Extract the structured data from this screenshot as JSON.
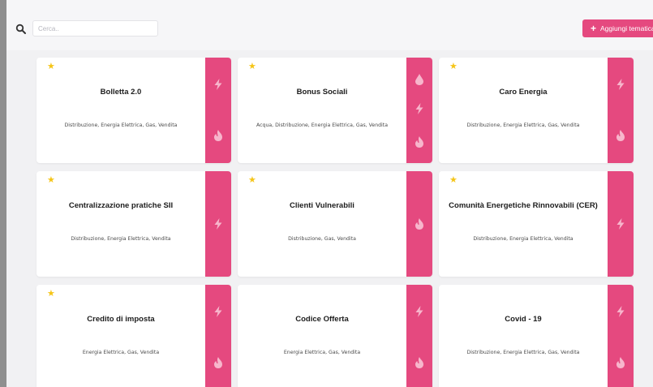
{
  "search": {
    "placeholder": "Cerca..",
    "icon": "search-icon"
  },
  "toolbar": {
    "add_label": "Aggiungi tematica",
    "add_icon": "plus"
  },
  "colors": {
    "accent": "#e5497f",
    "star": "#f5c518",
    "page_bg": "#f1f1f3"
  },
  "cards": [
    {
      "title": "Bolletta 2.0",
      "tags": "Distribuzione, Energia Elettrica, Gas, Vendita",
      "favorite": true,
      "icons": [
        "lightning-icon",
        "flame-icon"
      ]
    },
    {
      "title": "Bonus Sociali",
      "tags": "Acqua, Distribuzione, Energia Elettrica, Gas, Vendita",
      "favorite": true,
      "icons": [
        "water-drop-icon",
        "lightning-icon",
        "flame-icon"
      ]
    },
    {
      "title": "Caro Energia",
      "tags": "Distribuzione, Energia Elettrica, Gas, Vendita",
      "favorite": true,
      "icons": [
        "lightning-icon",
        "flame-icon"
      ]
    },
    {
      "title": "Centralizzazione pratiche SII",
      "tags": "Distribuzione, Energia Elettrica, Vendita",
      "favorite": true,
      "icons": [
        "lightning-icon"
      ]
    },
    {
      "title": "Clienti Vulnerabili",
      "tags": "Distribuzione, Gas, Vendita",
      "favorite": true,
      "icons": [
        "flame-icon"
      ]
    },
    {
      "title": "Comunità Energetiche Rinnovabili (CER)",
      "tags": "Distribuzione, Energia Elettrica, Vendita",
      "favorite": true,
      "icons": [
        "lightning-icon"
      ]
    },
    {
      "title": "Credito di imposta",
      "tags": "Energia Elettrica, Gas, Vendita",
      "favorite": true,
      "icons": [
        "lightning-icon",
        "flame-icon"
      ]
    },
    {
      "title": "Codice Offerta",
      "tags": "Energia Elettrica, Gas, Vendita",
      "favorite": false,
      "icons": [
        "lightning-icon",
        "flame-icon"
      ]
    },
    {
      "title": "Covid - 19",
      "tags": "Distribuzione, Energia Elettrica, Gas, Vendita",
      "favorite": false,
      "icons": [
        "lightning-icon",
        "flame-icon"
      ]
    }
  ]
}
